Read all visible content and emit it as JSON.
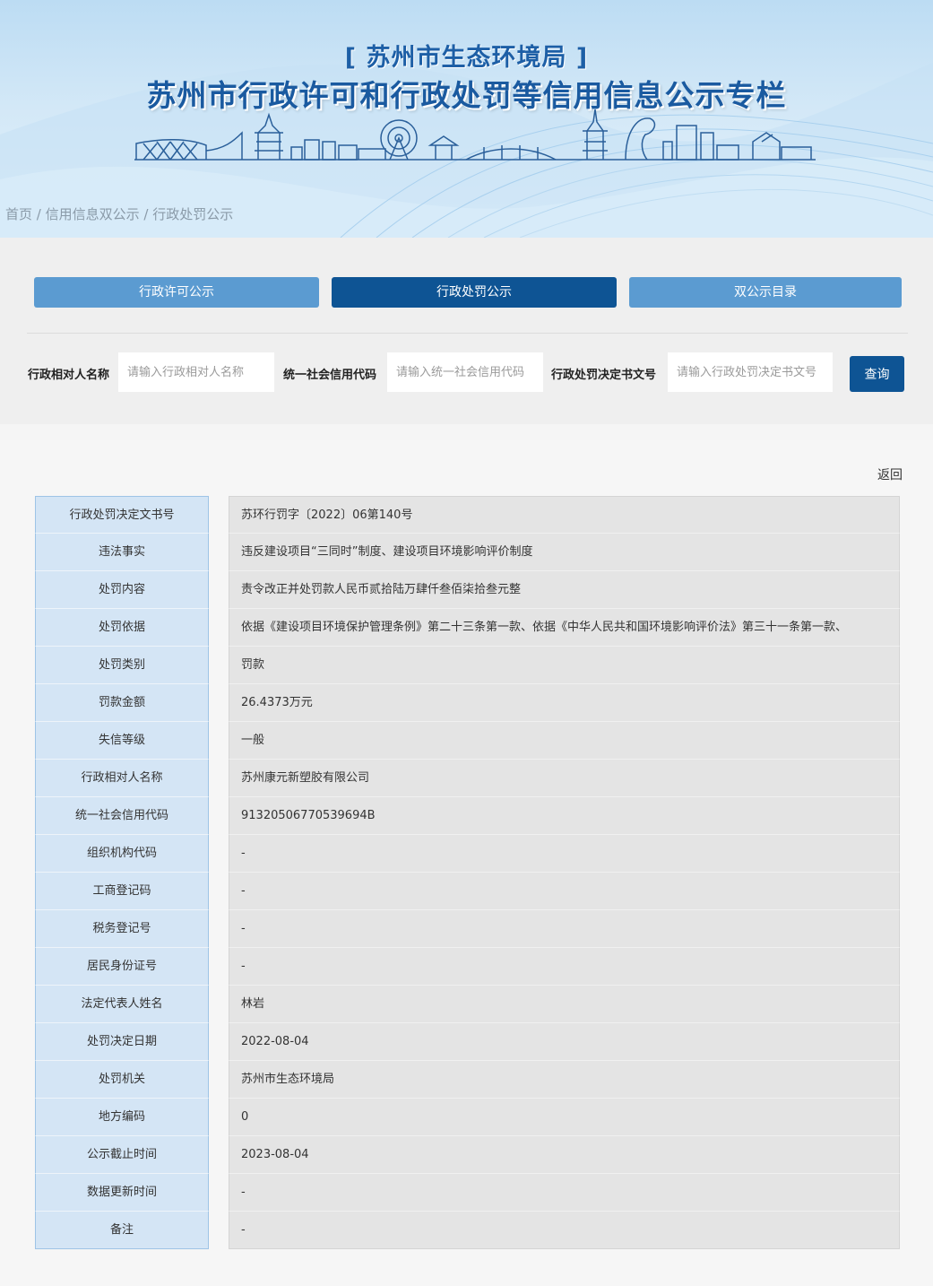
{
  "banner": {
    "subtitle": "[ 苏州市生态环境局 ]",
    "title": "苏州市行政许可和行政处罚等信用信息公示专栏",
    "accent_color": "#1a5aa0"
  },
  "breadcrumb": {
    "home": "首页",
    "sep1": " / ",
    "level2": "信用信息双公示",
    "sep2": " / ",
    "current": "行政处罚公示"
  },
  "tabs": [
    {
      "label": "行政许可公示",
      "active": false
    },
    {
      "label": "行政处罚公示",
      "active": true
    },
    {
      "label": "双公示目录",
      "active": false
    }
  ],
  "search": {
    "fields": [
      {
        "label": "行政相对人名称",
        "placeholder": "请输入行政相对人名称"
      },
      {
        "label": "统一社会信用代码",
        "placeholder": "请输入统一社会信用代码"
      },
      {
        "label": "行政处罚决定书文号",
        "placeholder": "请输入行政处罚决定书文号"
      }
    ],
    "button_label": "查询"
  },
  "detail": {
    "back_label": "返回",
    "rows": [
      {
        "label": "行政处罚决定文书号",
        "value": "苏环行罚字〔2022〕06第140号"
      },
      {
        "label": "违法事实",
        "value": "违反建设项目“三同时”制度、建设项目环境影响评价制度"
      },
      {
        "label": "处罚内容",
        "value": "责令改正并处罚款人民币贰拾陆万肆仟叁佰柒拾叁元整"
      },
      {
        "label": "处罚依据",
        "value": "依据《建设项目环境保护管理条例》第二十三条第一款、依据《中华人民共和国环境影响评价法》第三十一条第一款、"
      },
      {
        "label": "处罚类别",
        "value": "罚款"
      },
      {
        "label": "罚款金额",
        "value": "26.4373万元"
      },
      {
        "label": "失信等级",
        "value": "一般"
      },
      {
        "label": "行政相对人名称",
        "value": "苏州康元新塑胶有限公司"
      },
      {
        "label": "统一社会信用代码",
        "value": "91320506770539694B"
      },
      {
        "label": "组织机构代码",
        "value": "-"
      },
      {
        "label": "工商登记码",
        "value": "-"
      },
      {
        "label": "税务登记号",
        "value": "-"
      },
      {
        "label": "居民身份证号",
        "value": "-"
      },
      {
        "label": "法定代表人姓名",
        "value": "林岩"
      },
      {
        "label": "处罚决定日期",
        "value": "2022-08-04"
      },
      {
        "label": "处罚机关",
        "value": "苏州市生态环境局"
      },
      {
        "label": "地方编码",
        "value": "0"
      },
      {
        "label": "公示截止时间",
        "value": "2023-08-04"
      },
      {
        "label": "数据更新时间",
        "value": "-"
      },
      {
        "label": "备注",
        "value": "-"
      }
    ]
  }
}
